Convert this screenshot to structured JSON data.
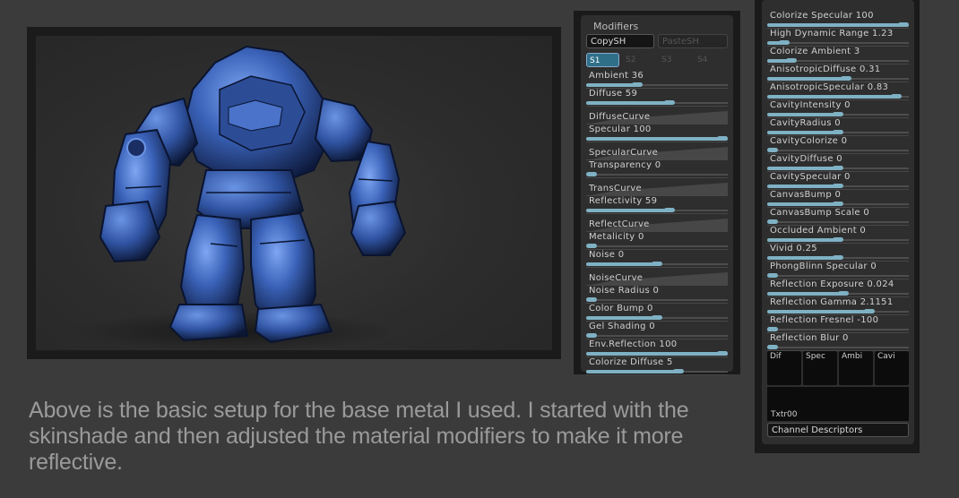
{
  "caption": "Above is the basic setup for the base metal I used. I started with the skinshade and then adjusted the material modifiers to make it more reflective.",
  "modifiers": {
    "title": "Modifiers",
    "copy_label": "CopySH",
    "paste_label": "PasteSH",
    "tabs": [
      "S1",
      "S2",
      "S3",
      "S4"
    ],
    "active_tab": "S1",
    "sliders": [
      {
        "label": "Ambient 36",
        "value": 0.36
      },
      {
        "label": "Diffuse 59",
        "value": 0.59
      },
      {
        "label": "DiffuseCurve"
      },
      {
        "label": "Specular 100",
        "value": 1.0
      },
      {
        "label": "SpecularCurve"
      },
      {
        "label": "Transparency 0",
        "value": 0.0
      },
      {
        "label": "TransCurve"
      },
      {
        "label": "Reflectivity 59",
        "value": 0.59
      },
      {
        "label": "ReflectCurve"
      },
      {
        "label": "Metalicity 0",
        "value": 0.0
      },
      {
        "label": "Noise 0",
        "value": 0.5
      },
      {
        "label": "NoiseCurve"
      },
      {
        "label": "Noise Radius 0",
        "value": 0.0
      },
      {
        "label": "Color Bump 0",
        "value": 0.5
      },
      {
        "label": "Gel Shading 0",
        "value": 0.0
      },
      {
        "label": "Env.Reflection 100",
        "value": 1.0
      },
      {
        "label": "Colorize Diffuse 5",
        "value": 0.65
      }
    ]
  },
  "modifiers2": {
    "sliders": [
      {
        "label": "Colorize Specular 100",
        "value": 1.0
      },
      {
        "label": "High Dynamic Range 1.23",
        "value": 0.12
      },
      {
        "label": "Colorize Ambient 3",
        "value": 0.17
      },
      {
        "label": "AnisotropicDiffuse 0.31",
        "value": 0.56
      },
      {
        "label": "AnisotropicSpecular 0.83",
        "value": 0.91
      },
      {
        "label": "CavityIntensity 0",
        "value": 0.5
      },
      {
        "label": "CavityRadius 0",
        "value": 0.5
      },
      {
        "label": "CavityColorize 0",
        "value": 0.0
      },
      {
        "label": "CavityDiffuse 0",
        "value": 0.5
      },
      {
        "label": "CavitySpecular 0",
        "value": 0.5
      },
      {
        "label": "CanvasBump 0",
        "value": 0.5
      },
      {
        "label": "CanvasBump Scale 0",
        "value": 0.0
      },
      {
        "label": "Occluded  Ambient 0",
        "value": 0.5
      },
      {
        "label": "Vivid 0.25",
        "value": 0.5
      },
      {
        "label": "PhongBlinn Specular 0",
        "value": 0.0
      },
      {
        "label": "Reflection Exposure 0.024",
        "value": 0.54
      },
      {
        "label": "Reflection Gamma 2.1151",
        "value": 0.72
      },
      {
        "label": "Reflection Fresnel -100",
        "value": 0.03
      },
      {
        "label": "Reflection Blur 0",
        "value": 0.0
      }
    ],
    "texture_slots": [
      "Dif",
      "Spec",
      "Ambi",
      "Cavi"
    ],
    "texture_name": "Txtr00",
    "channel_descriptors_label": "Channel Descriptors"
  },
  "colors": {
    "accent": "#7fb1c4",
    "robot": "#3a62b8"
  }
}
